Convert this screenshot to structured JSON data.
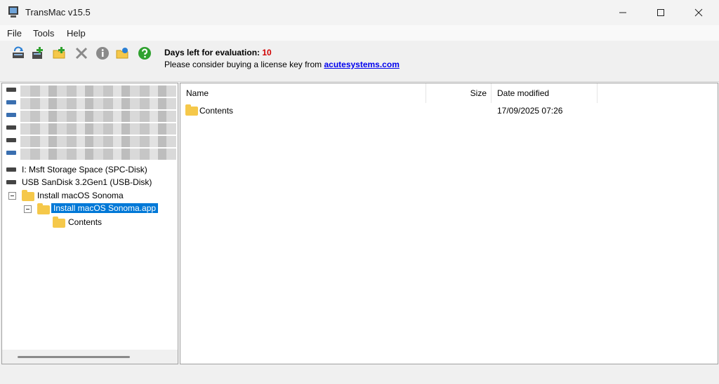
{
  "window": {
    "title": "TransMac v15.5"
  },
  "menu": {
    "file": "File",
    "tools": "Tools",
    "help": "Help"
  },
  "toolbar": {
    "icons": [
      "refresh-drive-icon",
      "add-drive-icon",
      "new-folder-icon",
      "delete-icon",
      "info-icon",
      "open-folder-icon",
      "help-icon"
    ],
    "eval_label": "Days left for evaluation:",
    "eval_days": "10",
    "license_text": "Please consider buying a license key from",
    "license_link": "acutesystems.com"
  },
  "tree": {
    "drives": [
      {
        "label": "I: Msft Storage Space (SPC-Disk)"
      },
      {
        "label": "USB SanDisk 3.2Gen1 (USB-Disk)"
      }
    ],
    "volume": {
      "label": "Install macOS Sonoma"
    },
    "app": {
      "label": "Install macOS Sonoma.app"
    },
    "contents": {
      "label": "Contents"
    }
  },
  "list": {
    "columns": {
      "name": "Name",
      "size": "Size",
      "date": "Date modified"
    },
    "rows": [
      {
        "name": "Contents",
        "size": "",
        "date": "17/09/2025 07:26"
      }
    ]
  },
  "colors": {
    "selection": "#0078d7",
    "folder": "#f5c84a",
    "eval_count": "#d00000",
    "link": "#0000ee"
  }
}
